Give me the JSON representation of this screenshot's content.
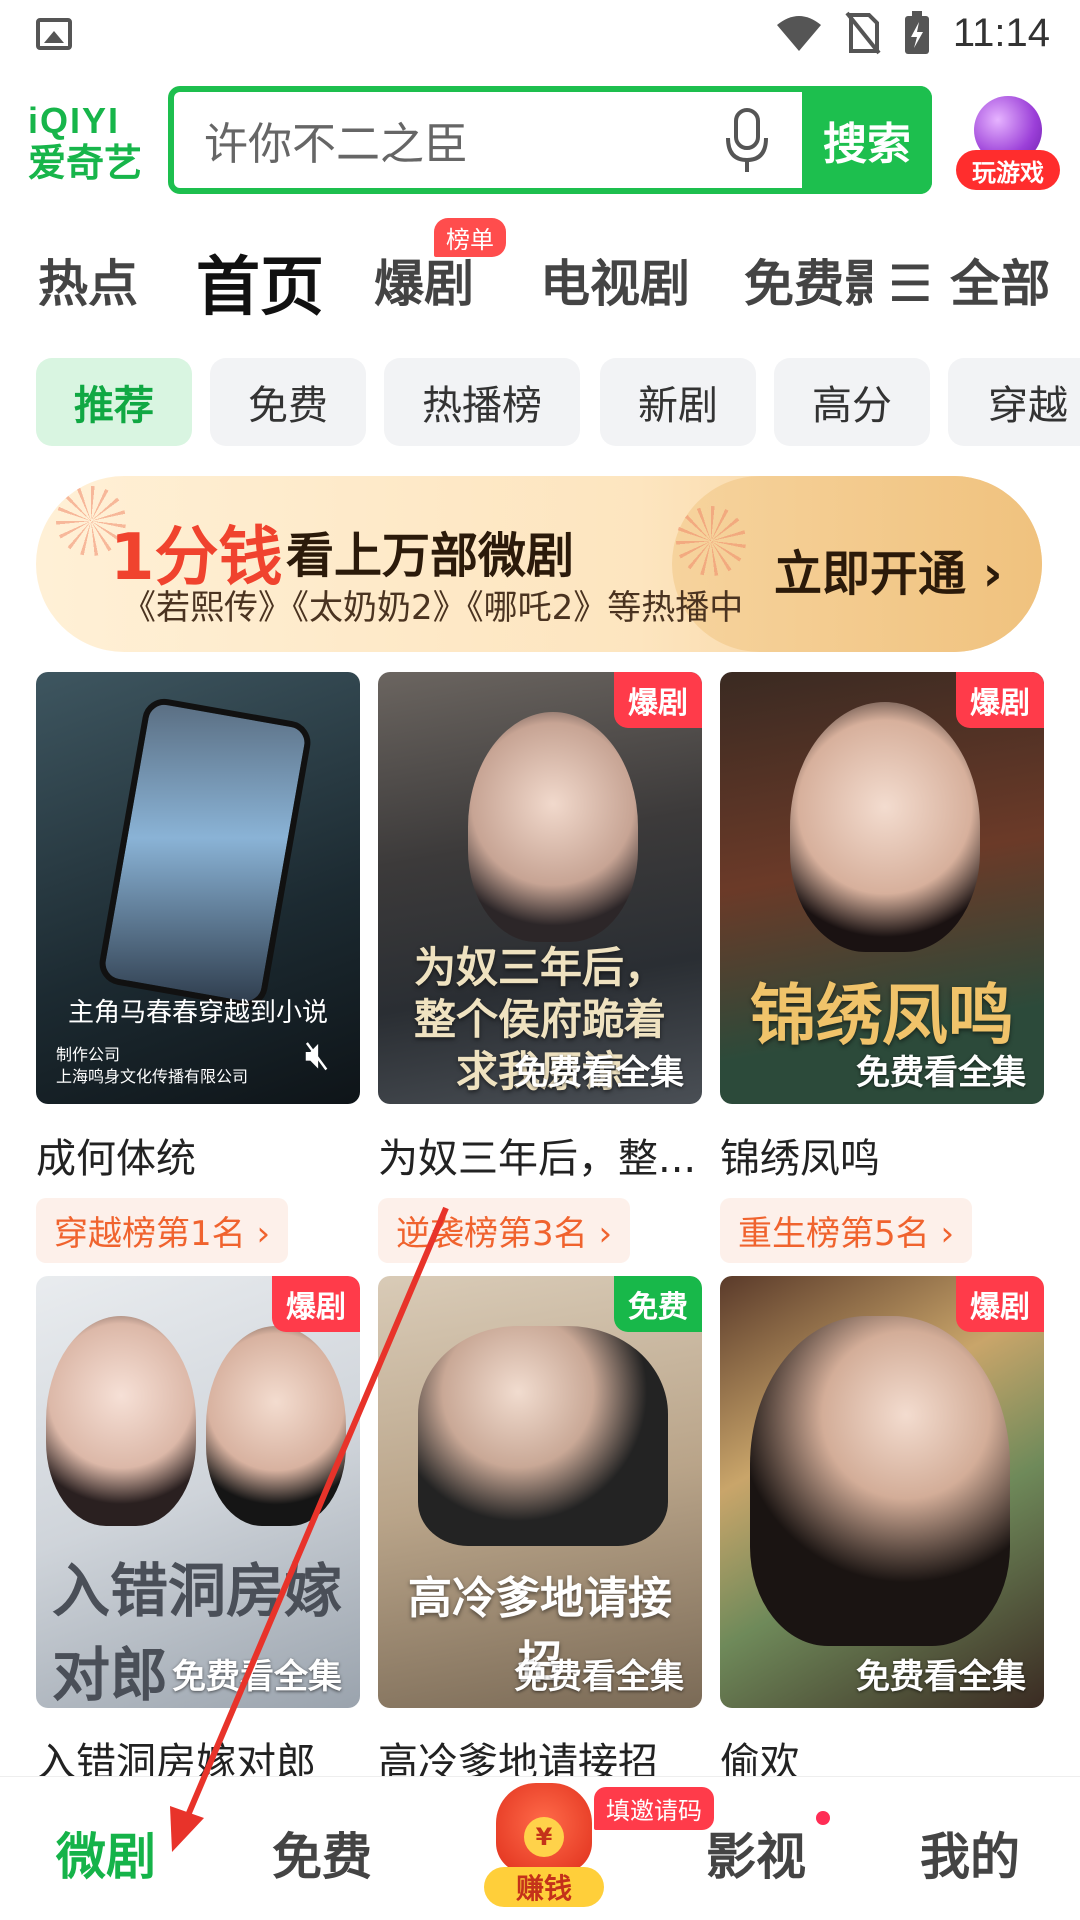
{
  "status_bar": {
    "time": "11:14",
    "icons": [
      "image-icon",
      "wifi-icon",
      "no-sim-icon",
      "battery-charging-icon"
    ]
  },
  "header": {
    "logo_top": "iQIYI",
    "logo_bottom": "爱奇艺",
    "search_placeholder": "许你不二之臣",
    "search_button": "搜索",
    "game_label": "玩游戏"
  },
  "top_tabs": {
    "items": [
      "热点",
      "首页",
      "爆剧",
      "电视剧",
      "免费影",
      "全部"
    ],
    "active": "首页",
    "badge": "榜单"
  },
  "chips": {
    "items": [
      "推荐",
      "免费",
      "热播榜",
      "新剧",
      "高分",
      "穿越"
    ],
    "active": "推荐"
  },
  "banner": {
    "price": "1分钱",
    "title": "看上万部微剧",
    "subtitle": "《若熙传》《太奶奶2》《哪吒2》等热播中",
    "cta": "立即开通 ›"
  },
  "cards": [
    {
      "title": "成何体统",
      "rank": "穿越榜第1名 ›",
      "tag": "",
      "overlay": "",
      "caption": "主角马春春穿越到小说",
      "company": "制作公司\n上海鸣身文化传播有限公司",
      "art": ""
    },
    {
      "title": "为奴三年后，整...",
      "rank": "逆袭榜第3名 ›",
      "tag": "爆剧",
      "overlay": "免费看全集",
      "art": "为奴三年后，整个侯府跪着求我原谅"
    },
    {
      "title": "锦绣凤鸣",
      "rank": "重生榜第5名 ›",
      "tag": "爆剧",
      "overlay": "免费看全集",
      "art": "锦绣凤鸣"
    },
    {
      "title": "入错洞房嫁对郎",
      "tag": "爆剧",
      "overlay": "免费看全集",
      "art": "入错洞房嫁对郎"
    },
    {
      "title": "高冷爹地请接招",
      "tag": "免费",
      "overlay": "免费看全集",
      "art": "高冷爹地请接招"
    },
    {
      "title": "偷欢",
      "tag": "爆剧",
      "overlay": "免费看全集",
      "art": ""
    }
  ],
  "bottom_nav": {
    "items": [
      "微剧",
      "免费",
      "赚钱",
      "影视",
      "我的"
    ],
    "active": "微剧",
    "invite_badge": "填邀请码",
    "coin_symbol": "¥"
  },
  "colors": {
    "brand_green": "#1dbf4e",
    "hot_red": "#ff3b4a",
    "rank_orange": "#f0632e"
  }
}
